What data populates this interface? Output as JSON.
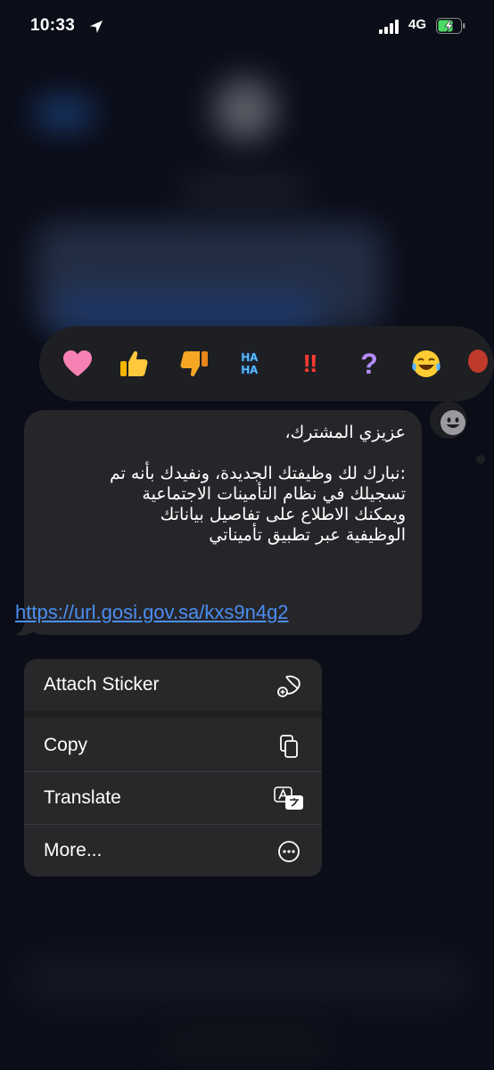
{
  "status_bar": {
    "time": "10:33",
    "network": "4G",
    "icons": [
      "location-arrow-icon",
      "signal-bars-icon",
      "battery-charging-icon"
    ]
  },
  "reactions": {
    "items": [
      {
        "name": "heart",
        "glyph": "heart-icon"
      },
      {
        "name": "thumbs-up",
        "glyph": "thumbs-up-icon"
      },
      {
        "name": "thumbs-down",
        "glyph": "thumbs-down-icon"
      },
      {
        "name": "haha",
        "label_top": "HA",
        "label_bottom": "HA"
      },
      {
        "name": "emphasize",
        "label": "‼"
      },
      {
        "name": "question",
        "label": "?"
      },
      {
        "name": "laugh-tears",
        "glyph": "laughing-tears-icon"
      },
      {
        "name": "balloon",
        "glyph": "balloon-icon"
      }
    ],
    "add_sticker_icon": "smiley-face-icon"
  },
  "message": {
    "text": "عزيزي المشترك،\n\n:نبارك لك وظيفتك الجديدة، ونفيدك بأنه تم\nتسجيلك في نظام التأمينات الاجتماعية\nويمكنك الاطلاع على تفاصيل بياناتك\nالوظيفية عبر تطبيق تأميناتي",
    "link": "https://url.gosi.gov.sa/kxs9n4g2"
  },
  "menu": {
    "items": [
      {
        "label": "Attach Sticker",
        "icon": "sticker-add-icon"
      },
      {
        "label": "Copy",
        "icon": "copy-icon"
      },
      {
        "label": "Translate",
        "icon": "translate-icon"
      },
      {
        "label": "More...",
        "icon": "ellipsis-circle-icon"
      }
    ]
  },
  "colors": {
    "background": "#0b0d18",
    "bubble": "#26262a",
    "menu": "#28282b",
    "link": "#4a8ef2",
    "battery_fill": "#4cd964"
  }
}
